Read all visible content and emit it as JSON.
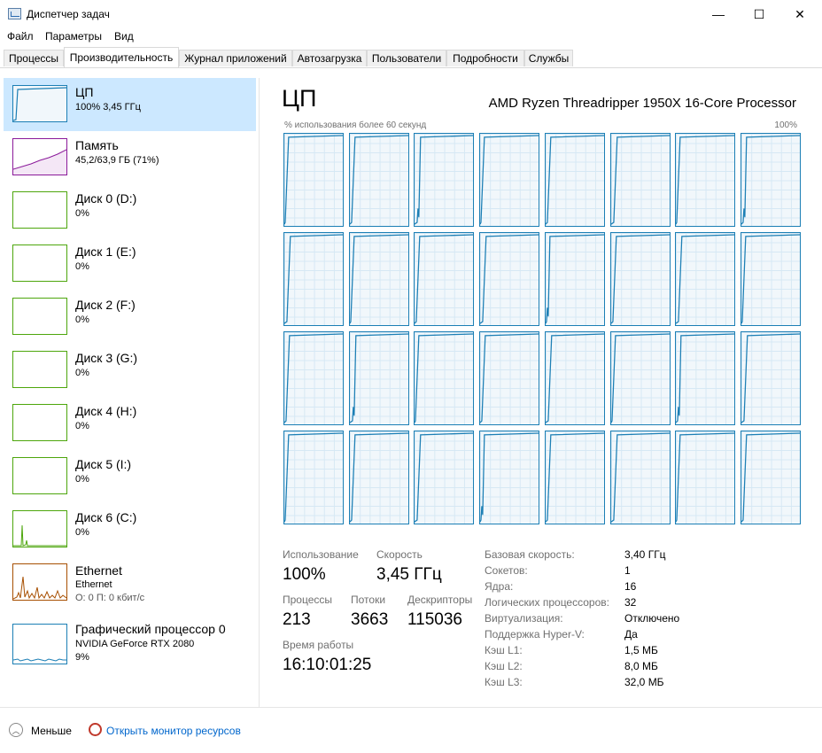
{
  "window": {
    "title": "Диспетчер задач",
    "minimize": "—",
    "maximize": "☐",
    "close": "✕"
  },
  "menu": [
    "Файл",
    "Параметры",
    "Вид"
  ],
  "tabs": [
    "Процессы",
    "Производительность",
    "Журнал приложений",
    "Автозагрузка",
    "Пользователи",
    "Подробности",
    "Службы"
  ],
  "active_tab": "Производительность",
  "sidebar": [
    {
      "name": "ЦП",
      "sub": [
        "100% 3,45 ГГц"
      ],
      "color": "#1c7fb5"
    },
    {
      "name": "Память",
      "sub": [
        "45,2/63,9 ГБ (71%)"
      ],
      "color": "#8b1a9a"
    },
    {
      "name": "Диск 0 (D:)",
      "sub": [
        "0%"
      ],
      "color": "#4da60c"
    },
    {
      "name": "Диск 1 (E:)",
      "sub": [
        "0%"
      ],
      "color": "#4da60c"
    },
    {
      "name": "Диск 2 (F:)",
      "sub": [
        "0%"
      ],
      "color": "#4da60c"
    },
    {
      "name": "Диск 3 (G:)",
      "sub": [
        "0%"
      ],
      "color": "#4da60c"
    },
    {
      "name": "Диск 4 (H:)",
      "sub": [
        "0%"
      ],
      "color": "#4da60c"
    },
    {
      "name": "Диск 5 (I:)",
      "sub": [
        "0%"
      ],
      "color": "#4da60c"
    },
    {
      "name": "Диск 6 (C:)",
      "sub": [
        "0%"
      ],
      "color": "#4da60c"
    },
    {
      "name": "Ethernet",
      "sub": [
        "Ethernet",
        "О: 0 П: 0 кбит/с"
      ],
      "color": "#a74f01"
    },
    {
      "name": "Графический процессор 0",
      "sub": [
        "NVIDIA GeForce RTX 2080",
        "9%"
      ],
      "color": "#1c7fb5"
    }
  ],
  "main": {
    "title": "ЦП",
    "model": "AMD Ryzen Threadripper 1950X 16-Core Processor",
    "graph_caption": "% использования более 60 секунд",
    "graph_max": "100%",
    "logical_processors_shown": 32,
    "stats": {
      "usage_label": "Использование",
      "usage_value": "100%",
      "speed_label": "Скорость",
      "speed_value": "3,45 ГГц",
      "processes_label": "Процессы",
      "processes_value": "213",
      "threads_label": "Потоки",
      "threads_value": "3663",
      "handles_label": "Дескрипторы",
      "handles_value": "115036",
      "uptime_label": "Время работы",
      "uptime_value": "16:10:01:25"
    },
    "info": [
      {
        "key": "Базовая скорость:",
        "value": "3,40 ГГц"
      },
      {
        "key": "Сокетов:",
        "value": "1"
      },
      {
        "key": "Ядра:",
        "value": "16"
      },
      {
        "key": "Логических процессоров:",
        "value": "32"
      },
      {
        "key": "Виртуализация:",
        "value": "Отключено"
      },
      {
        "key": "Поддержка Hyper-V:",
        "value": "Да"
      },
      {
        "key": "Кэш L1:",
        "value": "1,5 МБ"
      },
      {
        "key": "Кэш L2:",
        "value": "8,0 МБ"
      },
      {
        "key": "Кэш L3:",
        "value": "32,0 МБ"
      }
    ]
  },
  "footer": {
    "less_label": "Меньше",
    "monitor_link": "Открыть монитор ресурсов",
    "link_color": "#0066cc"
  }
}
